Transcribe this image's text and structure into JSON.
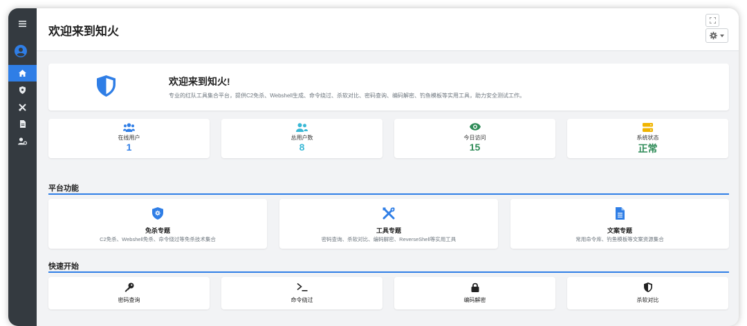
{
  "header": {
    "title": "欢迎来到知火"
  },
  "sidebar": {
    "items": [
      {
        "name": "home",
        "icon": "home-icon",
        "active": true
      },
      {
        "name": "shield",
        "icon": "shield-icon",
        "active": false
      },
      {
        "name": "tools",
        "icon": "tools-icon",
        "active": false
      },
      {
        "name": "documents",
        "icon": "document-icon",
        "active": false
      },
      {
        "name": "users",
        "icon": "user-cog-icon",
        "active": false
      }
    ]
  },
  "welcome": {
    "title": "欢迎来到知火!",
    "description": "专业的红队工具集合平台，提供C2免杀、Webshell生成、命令绕过、杀软对比、密码查询、编码解密、钓鱼模板等实用工具，助力安全测试工作。"
  },
  "stats": [
    {
      "label": "在线用户",
      "value": "1",
      "icon": "users-icon",
      "color": "#2f7ee6"
    },
    {
      "label": "总用户数",
      "value": "8",
      "icon": "user-friends-icon",
      "color": "#3ab8d6"
    },
    {
      "label": "今日访问",
      "value": "15",
      "icon": "eye-icon",
      "color": "#2e8b57"
    },
    {
      "label": "系统状态",
      "value": "正常",
      "icon": "server-icon",
      "color": "#2e8b57"
    }
  ],
  "sections": {
    "features": "平台功能",
    "quick_start": "快速开始"
  },
  "features": [
    {
      "name": "免杀专题",
      "desc": "C2免杀、Webshell免杀、命令绕过等免杀技术集合",
      "icon": "shield-virus-icon"
    },
    {
      "name": "工具专题",
      "desc": "密码查询、杀软对比、编码解密、ReverseShell等实用工具",
      "icon": "tools-icon"
    },
    {
      "name": "文案专题",
      "desc": "常用命令库、钓鱼模板等文案资源集合",
      "icon": "file-icon"
    }
  ],
  "quick": [
    {
      "label": "密码查询",
      "icon": "key-icon"
    },
    {
      "label": "命令绕过",
      "icon": "terminal-icon"
    },
    {
      "label": "编码解密",
      "icon": "lock-icon"
    },
    {
      "label": "杀软对比",
      "icon": "shield-half-icon"
    }
  ],
  "colors": {
    "accent": "#2f7ee6",
    "sidebar": "#343a40",
    "success": "#2e8b57",
    "info": "#3ab8d6",
    "warning": "#f0b400"
  }
}
